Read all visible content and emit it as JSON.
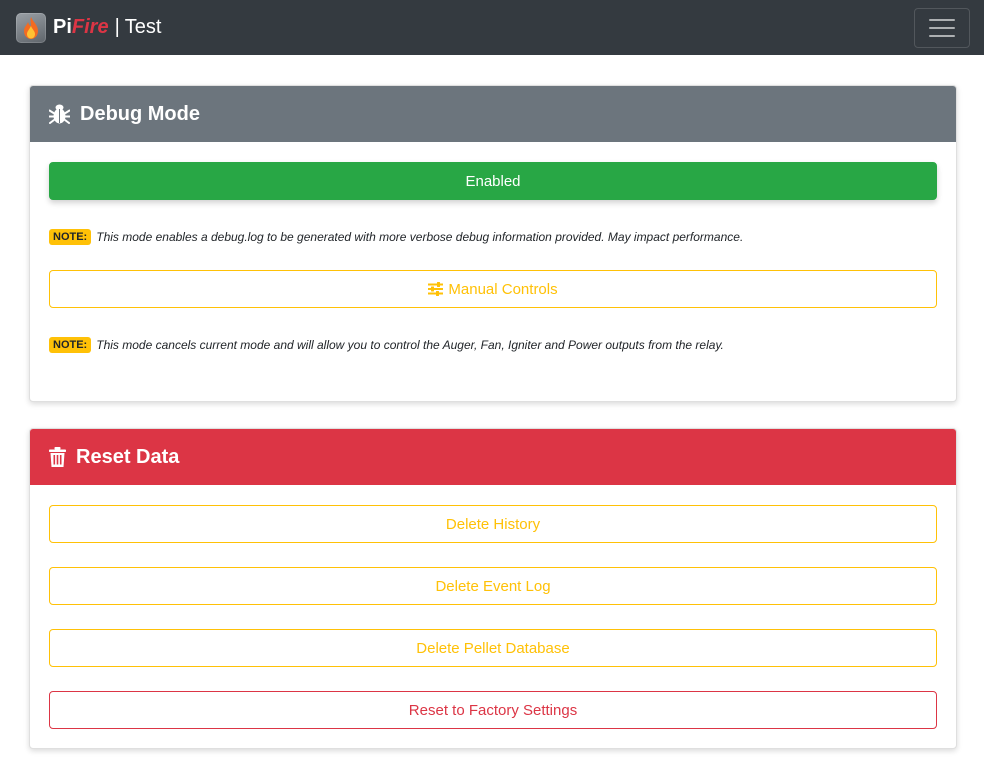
{
  "navbar": {
    "brand_pi": "Pi",
    "brand_fire": "Fire",
    "separator": "|",
    "brand_name": "Test",
    "menu_icon": "hamburger-menu-icon"
  },
  "debug": {
    "title": "Debug Mode",
    "icon": "bug-icon",
    "status_button": "Enabled",
    "note1_label": "NOTE:",
    "note1_text": "This mode enables a debug.log to be generated with more verbose debug information provided. May impact performance.",
    "manual_icon": "sliders-icon",
    "manual_button": "Manual Controls",
    "note2_label": "NOTE:",
    "note2_text": "This mode cancels current mode and will allow you to control the Auger, Fan, Igniter and Power outputs from the relay."
  },
  "reset": {
    "title": "Reset Data",
    "icon": "trash-icon",
    "buttons": [
      "Delete History",
      "Delete Event Log",
      "Delete Pellet Database",
      "Reset to Factory Settings"
    ]
  },
  "colors": {
    "navbar_bg": "#343a40",
    "debug_header": "#6c757d",
    "reset_header": "#dc3545",
    "success": "#28a745",
    "warning": "#ffc107",
    "danger": "#dc3545"
  }
}
